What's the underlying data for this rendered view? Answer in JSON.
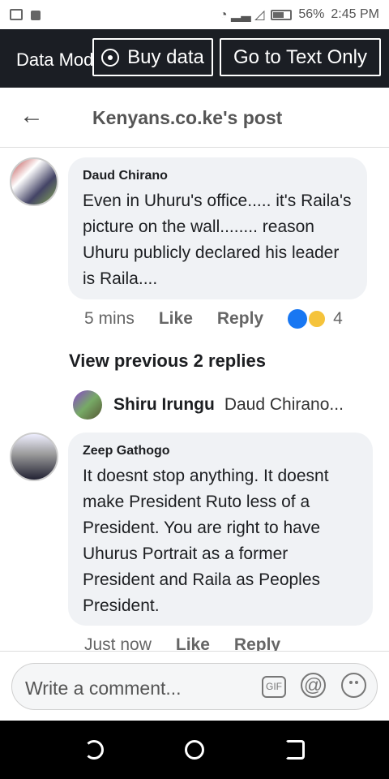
{
  "status": {
    "battery": "56%",
    "time": "2:45 PM"
  },
  "topbar": {
    "data_mode": "Data Mode",
    "buy_data": "Buy data",
    "text_only": "Go to Text Only"
  },
  "header": {
    "title": "Kenyans.co.ke's post"
  },
  "comments": [
    {
      "name": "Daud Chirano",
      "text": "Even in Uhuru's office..... it's Raila's picture on the wall........ reason Uhuru publicly declared his leader is Raila....",
      "time": "5 mins",
      "like": "Like",
      "reply": "Reply",
      "reaction_count": "4"
    },
    {
      "name": "Zeep Gathogo",
      "text": "It doesnt stop anything. It doesnt make President Ruto less of a President. You are right to have Uhurus Portrait as a former President and Raila as Peoples President.",
      "time": "Just now",
      "like": "Like",
      "reply": "Reply"
    }
  ],
  "view_previous": "View previous 2 replies",
  "reply_preview": {
    "name": "Shiru Irungu",
    "text": "Daud Chirano..."
  },
  "composer": {
    "placeholder": "Write a comment...",
    "gif": "GIF",
    "at": "@"
  }
}
